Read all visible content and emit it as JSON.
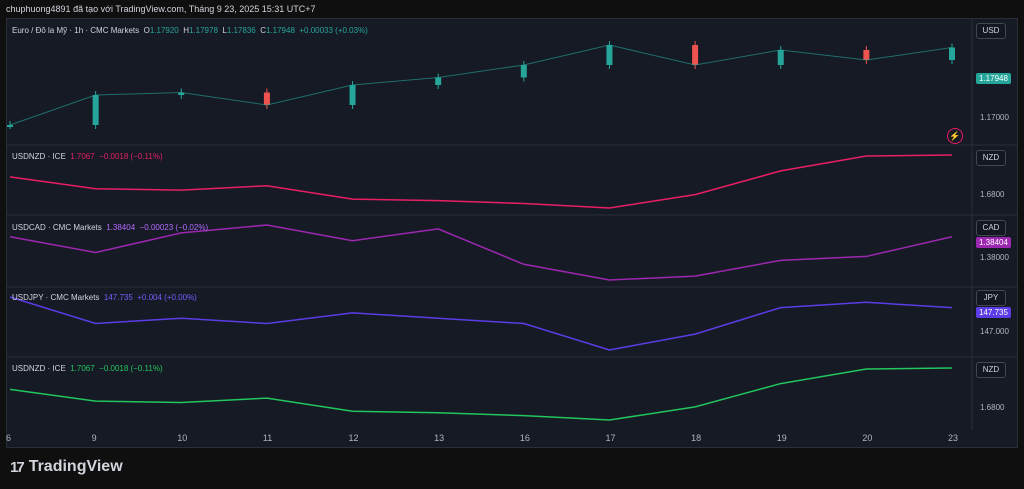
{
  "header": {
    "caption": "chuphuong4891 đã tạo với TradingView.com, Tháng 9 23, 2025 15:31 UTC+7"
  },
  "main_pane": {
    "title": "Euro / Đô la Mỹ · 1h · CMC Markets",
    "o_label": "O",
    "o_value": "1.17920",
    "h_label": "H",
    "h_value": "1.17978",
    "l_label": "L",
    "l_value": "1.17836",
    "c_label": "C",
    "c_value": "1.17948",
    "change": "+0.00033 (+0.03%)",
    "currency": "USD",
    "last_price": "1.17948",
    "axis_tick": "1.17000"
  },
  "panes": [
    {
      "symbol": "USDNZD · ICE",
      "value": "1.7067",
      "change": "−0.0018 (−0.11%)",
      "currency": "NZD",
      "axis_tick": "1.6800",
      "color": "#e91e63"
    },
    {
      "symbol": "USDCAD · CMC Markets",
      "value": "1.38404",
      "change": "−0.00023 (−0.02%)",
      "currency": "CAD",
      "axis_tick": "1.38000",
      "last_price": "1.38404",
      "color": "#9c27b0"
    },
    {
      "symbol": "USDJPY · CMC Markets",
      "value": "147.735",
      "change": "+0.004 (+0.00%)",
      "currency": "JPY",
      "axis_tick": "147.000",
      "last_price": "147.735",
      "color": "#5b3ce6"
    },
    {
      "symbol": "USDNZD · ICE",
      "value": "1.7067",
      "change": "−0.0018 (−0.11%)",
      "currency": "NZD",
      "axis_tick": "1.6800",
      "color": "#22c55e"
    }
  ],
  "x_axis": {
    "labels": [
      "6",
      "9",
      "10",
      "11",
      "12",
      "13",
      "16",
      "17",
      "18",
      "19",
      "20",
      "23"
    ]
  },
  "footer": {
    "brand": "TradingView"
  },
  "chart_data": {
    "type": "line",
    "x": [
      "6",
      "9",
      "10",
      "11",
      "12",
      "13",
      "16",
      "17",
      "18",
      "19",
      "20",
      "23"
    ],
    "series": [
      {
        "name": "Euro / Đô la Mỹ",
        "values": [
          1.164,
          1.17,
          1.1705,
          1.168,
          1.172,
          1.1735,
          1.176,
          1.18,
          1.176,
          1.179,
          1.177,
          1.1795
        ]
      },
      {
        "name": "USDNZD · ICE",
        "values": [
          1.692,
          1.684,
          1.683,
          1.686,
          1.677,
          1.676,
          1.674,
          1.671,
          1.68,
          1.696,
          1.706,
          1.7067
        ]
      },
      {
        "name": "USDCAD · CMC Markets",
        "values": [
          1.384,
          1.382,
          1.3845,
          1.3855,
          1.3835,
          1.385,
          1.3805,
          1.3785,
          1.379,
          1.381,
          1.3815,
          1.384
        ]
      },
      {
        "name": "USDJPY · CMC Markets",
        "values": [
          147.9,
          147.4,
          147.5,
          147.4,
          147.6,
          147.5,
          147.4,
          146.9,
          147.2,
          147.7,
          147.8,
          147.7
        ]
      }
    ]
  }
}
